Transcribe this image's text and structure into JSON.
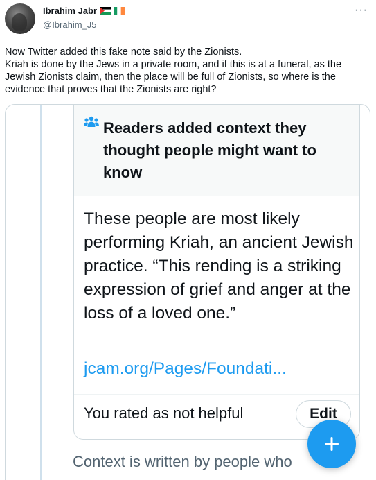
{
  "tweet": {
    "display_name": "Ibrahim Jabr",
    "handle": "@Ibrahim_J5",
    "flags": [
      "palestine-flag-icon",
      "ireland-flag-icon"
    ],
    "more_label": "···",
    "text": "Now Twitter added this fake note said by the Zionists.\nKriah is done by the Jews in a private room, and if this is at a funeral, as the Jewish Zionists claim, then the place will be full of Zionists, so where is the evidence that proves that the Zionists are right?"
  },
  "community_note": {
    "title": "Readers added context they thought people might want to know",
    "body": "These people are most likely performing Kriah, an ancient Jewish practice. “This rending is a striking expression of grief and anger at the loss of a loved one.”",
    "link": "jcam.org/Pages/Foundati...",
    "rated_text": "You rated as not helpful",
    "edit_label": "Edit",
    "footer_text": "Context is written by people who"
  },
  "colors": {
    "accent": "#1d9bf0",
    "text": "#0f1419",
    "muted": "#536471",
    "border": "#cfd9de"
  }
}
